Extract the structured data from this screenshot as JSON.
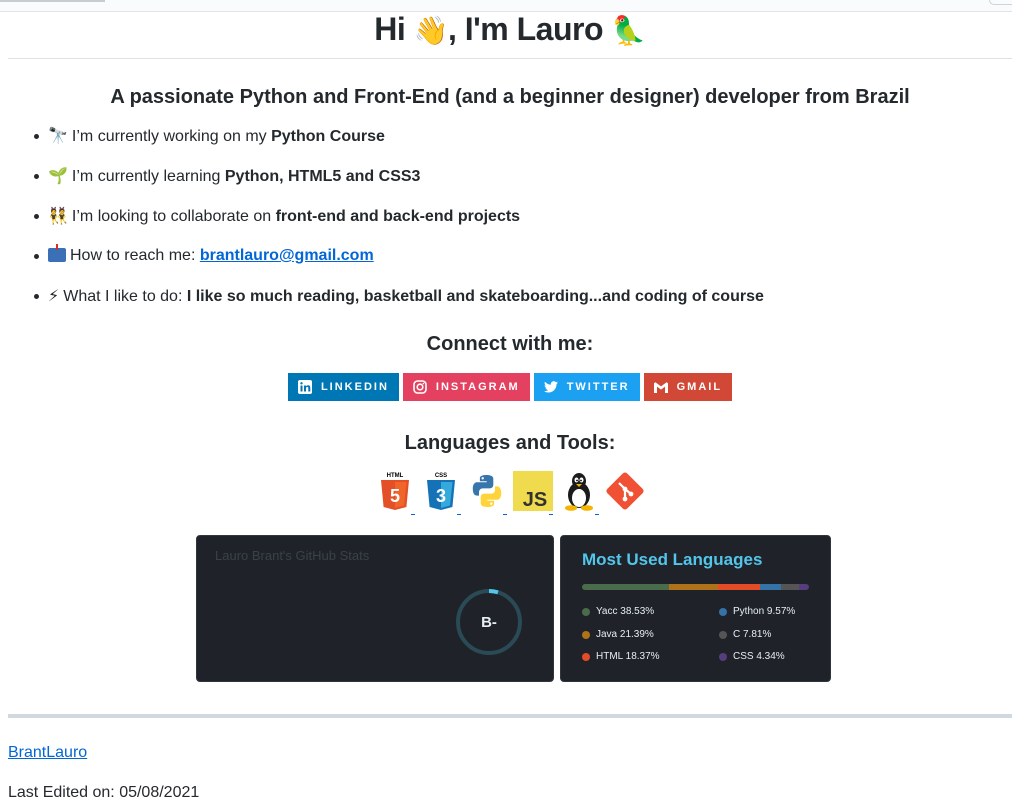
{
  "header": {
    "title_pre": "Hi ",
    "wave_emoji": "👋",
    "title_post": ", I'm Lauro ",
    "bird_emoji": "🦜"
  },
  "subtitle": "A passionate Python and Front-End (and a beginner designer) developer from Brazil",
  "items": [
    {
      "emoji": "🔭",
      "text": "I’m currently working on my ",
      "bold": "Python Course"
    },
    {
      "emoji": "🌱",
      "text": "I’m currently learning ",
      "bold": "Python, HTML5 and CSS3"
    },
    {
      "emoji": "👯",
      "text": "I’m looking to collaborate on ",
      "bold": "front-end and back-end projects"
    },
    {
      "emoji": "mailbox-icon",
      "text": "How to reach me: ",
      "link": "brantlauro@gmail.com"
    },
    {
      "emoji": "⚡",
      "text": "What I like to do: ",
      "bold": "I like so much reading, basketball and skateboarding...and coding of course"
    }
  ],
  "connect_title": "Connect with me:",
  "badges": [
    {
      "label": "LINKEDIN",
      "icon": "linkedin-icon",
      "color": "#0077b5"
    },
    {
      "label": "INSTAGRAM",
      "icon": "instagram-icon",
      "color": "#e4405f"
    },
    {
      "label": "TWITTER",
      "icon": "twitter-icon",
      "color": "#1ca0f2"
    },
    {
      "label": "GMAIL",
      "icon": "gmail-icon",
      "color": "#d14836"
    }
  ],
  "languages_title": "Languages and Tools:",
  "tools": [
    {
      "name": "html5-icon",
      "label": "HTML",
      "badge": "5"
    },
    {
      "name": "css3-icon",
      "label": "CSS",
      "badge": "3"
    },
    {
      "name": "python-icon"
    },
    {
      "name": "javascript-icon",
      "badge": "JS"
    },
    {
      "name": "linux-icon"
    },
    {
      "name": "git-icon"
    }
  ],
  "stats_card": {
    "title": "Lauro Brant's GitHub Stats",
    "grade": "B-"
  },
  "langs_card": {
    "title": "Most Used Languages",
    "languages": [
      {
        "name": "Yacc",
        "percent": 38.53,
        "label": "Yacc 38.53%",
        "color": "#4b6c4b"
      },
      {
        "name": "Java",
        "percent": 21.39,
        "label": "Java 21.39%",
        "color": "#b07219"
      },
      {
        "name": "HTML",
        "percent": 18.37,
        "label": "HTML 18.37%",
        "color": "#e34c26"
      },
      {
        "name": "Python",
        "percent": 9.57,
        "label": "Python 9.57%",
        "color": "#3572a5"
      },
      {
        "name": "C",
        "percent": 7.81,
        "label": "C 7.81%",
        "color": "#555555"
      },
      {
        "name": "CSS",
        "percent": 4.34,
        "label": "CSS 4.34%",
        "color": "#563d7c"
      }
    ]
  },
  "footer": {
    "link": "BrantLauro",
    "edited": "Last Edited on: 05/08/2021"
  }
}
